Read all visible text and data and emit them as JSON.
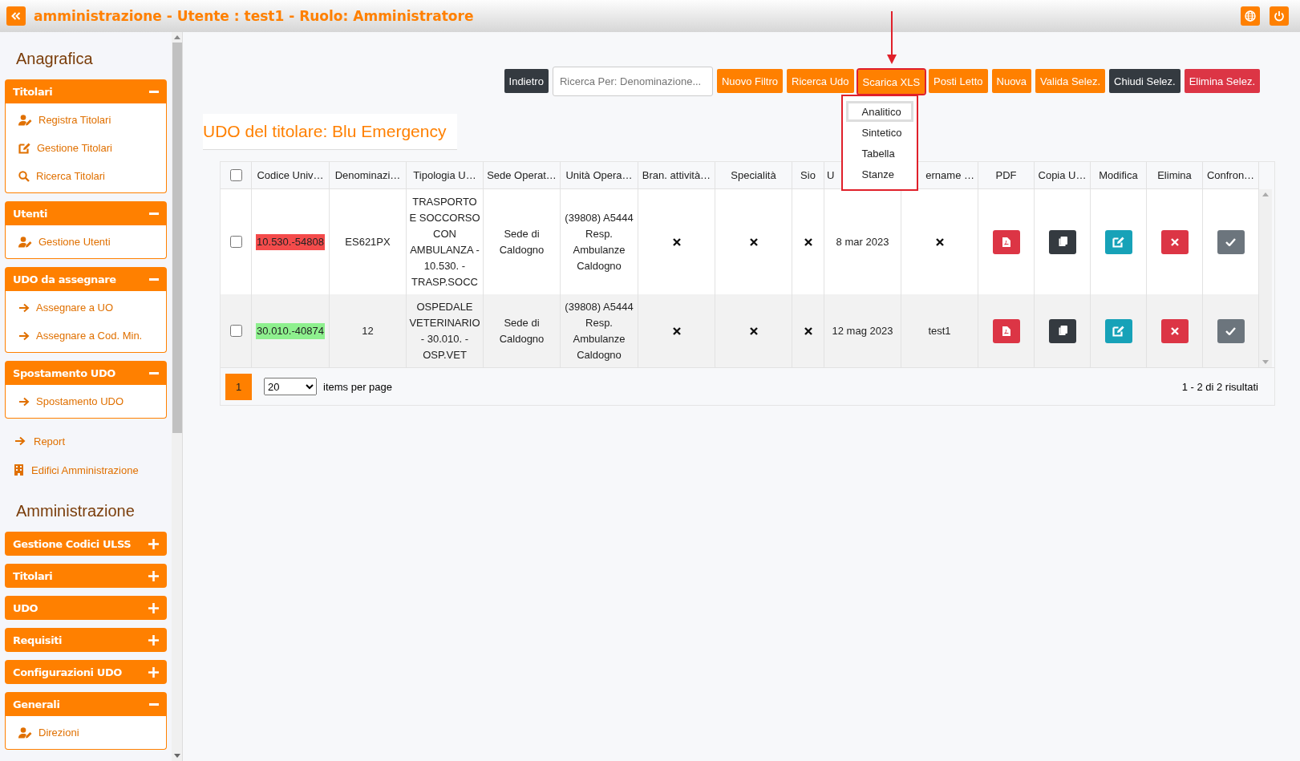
{
  "header": {
    "title": "amministrazione - Utente : test1 - Ruolo: Amministratore"
  },
  "sidebar": [
    {
      "kind": "heading",
      "label": "Anagrafica"
    },
    {
      "kind": "group",
      "label": "Titolari",
      "expanded": true,
      "items": [
        {
          "kind": "user",
          "label": "Registra Titolari"
        },
        {
          "kind": "edit",
          "label": "Gestione Titolari"
        },
        {
          "kind": "search",
          "label": "Ricerca Titolari"
        }
      ]
    },
    {
      "kind": "group",
      "label": "Utenti",
      "expanded": true,
      "items": [
        {
          "kind": "user",
          "label": "Gestione Utenti"
        }
      ]
    },
    {
      "kind": "group",
      "label": "UDO da assegnare",
      "expanded": true,
      "items": [
        {
          "kind": "arrow",
          "label": "Assegnare a UO"
        },
        {
          "kind": "arrow",
          "label": "Assegnare a Cod. Min."
        }
      ]
    },
    {
      "kind": "group",
      "label": "Spostamento UDO",
      "expanded": true,
      "items": [
        {
          "kind": "arrow",
          "label": "Spostamento UDO"
        }
      ]
    },
    {
      "kind": "link",
      "label": "Report"
    },
    {
      "kind": "link",
      "label": "Edifici Amministrazione"
    },
    {
      "kind": "heading",
      "label": "Amministrazione"
    },
    {
      "kind": "group",
      "label": "Gestione Codici ULSS",
      "expanded": false
    },
    {
      "kind": "group",
      "label": "Titolari",
      "expanded": false
    },
    {
      "kind": "group",
      "label": "UDO",
      "expanded": false
    },
    {
      "kind": "group",
      "label": "Requisiti",
      "expanded": false
    },
    {
      "kind": "group",
      "label": "Configurazioni UDO",
      "expanded": false
    },
    {
      "kind": "group",
      "label": "Generali",
      "expanded": true,
      "items": [
        {
          "kind": "user",
          "label": "Direzioni"
        }
      ]
    }
  ],
  "toolbar": {
    "back": {
      "label": "Indietro",
      "kind": "dark"
    },
    "search": {
      "placeholder": "Ricerca Per: Denominazione..."
    },
    "buttons": [
      {
        "label": "Nuovo Filtro",
        "kind": "orange",
        "highlighted": false
      },
      {
        "label": "Ricerca Udo",
        "kind": "orange",
        "highlighted": false
      },
      {
        "label": "Scarica XLS",
        "kind": "orange",
        "highlighted": true
      },
      {
        "label": "Posti Letto",
        "kind": "orange",
        "highlighted": false
      },
      {
        "label": "Nuova",
        "kind": "orange",
        "highlighted": false
      },
      {
        "label": "Valida Selez.",
        "kind": "orange",
        "highlighted": false
      },
      {
        "label": "Chiudi Selez.",
        "kind": "dark",
        "highlighted": false
      },
      {
        "label": "Elimina Selez.",
        "kind": "red",
        "highlighted": false
      }
    ],
    "dropdown": [
      {
        "label": "Analitico",
        "selected": true
      },
      {
        "label": "Sintetico",
        "selected": false
      },
      {
        "label": "Tabella",
        "selected": false
      },
      {
        "label": "Stanze",
        "selected": false
      }
    ]
  },
  "title": "UDO del titolare: Blu Emergency",
  "table": {
    "select_all": {
      "checked": false
    },
    "columns": [
      {
        "label": "Codice Univ…",
        "kind": "data"
      },
      {
        "label": "Denominazi…",
        "kind": "data"
      },
      {
        "label": "Tipologia U…",
        "kind": "data"
      },
      {
        "label": "Sede Operat…",
        "kind": "data"
      },
      {
        "label": "Unità Opera…",
        "kind": "data"
      },
      {
        "label": "Bran. attività…",
        "kind": "data"
      },
      {
        "label": "Specialità",
        "kind": "data"
      },
      {
        "label": "Sio",
        "kind": "data"
      },
      {
        "label": "U",
        "kind": "data"
      },
      {
        "label": "ername …",
        "kind": "data"
      },
      {
        "label": "PDF",
        "kind": "pdf"
      },
      {
        "label": "Copia U…",
        "kind": "copy"
      },
      {
        "label": "Modifica",
        "kind": "edit"
      },
      {
        "label": "Elimina",
        "kind": "delete"
      },
      {
        "label": "Confron…",
        "kind": "compare"
      }
    ],
    "rows": [
      {
        "checked": false,
        "color": "#f44b4b",
        "cells": [
          {
            "kind": "text",
            "text": "10.530.-54808"
          },
          {
            "kind": "text",
            "text": "ES621PX"
          },
          {
            "kind": "text",
            "text": "TRASPORTO E SOCCORSO CON AMBULANZA - 10.530. - TRASP.SOCC"
          },
          {
            "kind": "text",
            "text": "Sede di Caldogno"
          },
          {
            "kind": "text",
            "text": "(39808) A5444 Resp. Ambulanze Caldogno"
          },
          {
            "kind": "cross"
          },
          {
            "kind": "cross"
          },
          {
            "kind": "cross"
          },
          {
            "kind": "text",
            "text": "8 mar 2023"
          },
          {
            "kind": "cross"
          }
        ]
      },
      {
        "checked": false,
        "color": "#8ef08e",
        "cells": [
          {
            "kind": "text",
            "text": "30.010.-40874"
          },
          {
            "kind": "text",
            "text": "12"
          },
          {
            "kind": "text",
            "text": "OSPEDALE VETERINARIO - 30.010. - OSP.VET"
          },
          {
            "kind": "text",
            "text": "Sede di Caldogno"
          },
          {
            "kind": "text",
            "text": "(39808) A5444 Resp. Ambulanze Caldogno"
          },
          {
            "kind": "cross"
          },
          {
            "kind": "cross"
          },
          {
            "kind": "cross"
          },
          {
            "kind": "text",
            "text": "12 mag 2023"
          },
          {
            "kind": "text",
            "text": "test1"
          }
        ]
      }
    ]
  },
  "pagination": {
    "pages": [
      {
        "label": "1",
        "selected": true
      }
    ],
    "per_page": "20",
    "per_page_label": "items per page",
    "summary": "1 - 2 di 2 risultati"
  }
}
